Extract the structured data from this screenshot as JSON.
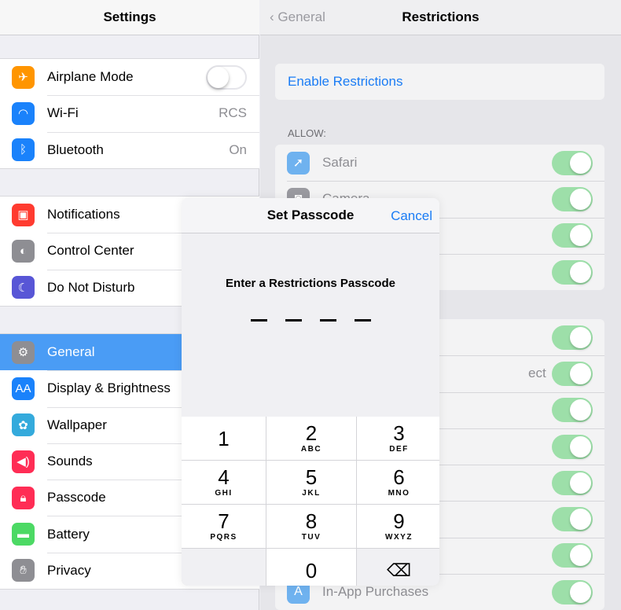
{
  "left": {
    "title": "Settings",
    "groups": [
      [
        {
          "label": "Airplane Mode",
          "icon": "airplane-icon",
          "color": "#ff9500",
          "toggle": false
        },
        {
          "label": "Wi-Fi",
          "icon": "wifi-icon",
          "color": "#1a82fb",
          "value": "RCS"
        },
        {
          "label": "Bluetooth",
          "icon": "bluetooth-icon",
          "color": "#1a82fb",
          "value": "On"
        }
      ],
      [
        {
          "label": "Notifications",
          "icon": "notifications-icon",
          "color": "#ff3b30"
        },
        {
          "label": "Control Center",
          "icon": "control-center-icon",
          "color": "#8e8e93"
        },
        {
          "label": "Do Not Disturb",
          "icon": "moon-icon",
          "color": "#5856d6"
        }
      ],
      [
        {
          "label": "General",
          "icon": "gear-icon",
          "color": "#8e8e93",
          "selected": true
        },
        {
          "label": "Display & Brightness",
          "icon": "display-icon",
          "color": "#1a82fb"
        },
        {
          "label": "Wallpaper",
          "icon": "wallpaper-icon",
          "color": "#34aadc"
        },
        {
          "label": "Sounds",
          "icon": "speaker-icon",
          "color": "#ff2d55"
        },
        {
          "label": "Passcode",
          "icon": "lock-icon",
          "color": "#ff2d55"
        },
        {
          "label": "Battery",
          "icon": "battery-icon",
          "color": "#4cd964"
        },
        {
          "label": "Privacy",
          "icon": "hand-icon",
          "color": "#8e8e93"
        }
      ]
    ]
  },
  "right": {
    "back": "General",
    "title": "Restrictions",
    "enable": "Enable Restrictions",
    "allow_label": "ALLOW:",
    "group1": [
      {
        "label": "Safari",
        "icon": "safari-icon",
        "on": true
      },
      {
        "label": "Camera",
        "icon": "camera-icon",
        "on": true
      },
      {
        "label": "",
        "on": true
      },
      {
        "label": "",
        "on": true
      }
    ],
    "group2": [
      {
        "label": "",
        "on": true
      },
      {
        "label": "ect",
        "on": true
      },
      {
        "label": "",
        "on": true
      },
      {
        "label": "",
        "on": true
      },
      {
        "label": "",
        "on": true
      },
      {
        "label": "",
        "on": true
      },
      {
        "label": "",
        "on": true
      },
      {
        "label": "In-App Purchases",
        "icon": "app-store-icon",
        "on": true
      }
    ]
  },
  "dialog": {
    "title": "Set Passcode",
    "cancel": "Cancel",
    "prompt": "Enter a Restrictions Passcode",
    "digits_entered": 0,
    "digits_total": 4,
    "keys": [
      {
        "n": "1",
        "s": ""
      },
      {
        "n": "2",
        "s": "ABC"
      },
      {
        "n": "3",
        "s": "DEF"
      },
      {
        "n": "4",
        "s": "GHI"
      },
      {
        "n": "5",
        "s": "JKL"
      },
      {
        "n": "6",
        "s": "MNO"
      },
      {
        "n": "7",
        "s": "PQRS"
      },
      {
        "n": "8",
        "s": "TUV"
      },
      {
        "n": "9",
        "s": "WXYZ"
      },
      {
        "n": "",
        "s": ""
      },
      {
        "n": "0",
        "s": ""
      },
      {
        "n": "⌫",
        "s": "",
        "icon": "delete-icon"
      }
    ]
  },
  "colors": {
    "accent": "#1a7cf5",
    "selected": "#4a9cf5",
    "toggle_on": "#9ddfa9"
  }
}
